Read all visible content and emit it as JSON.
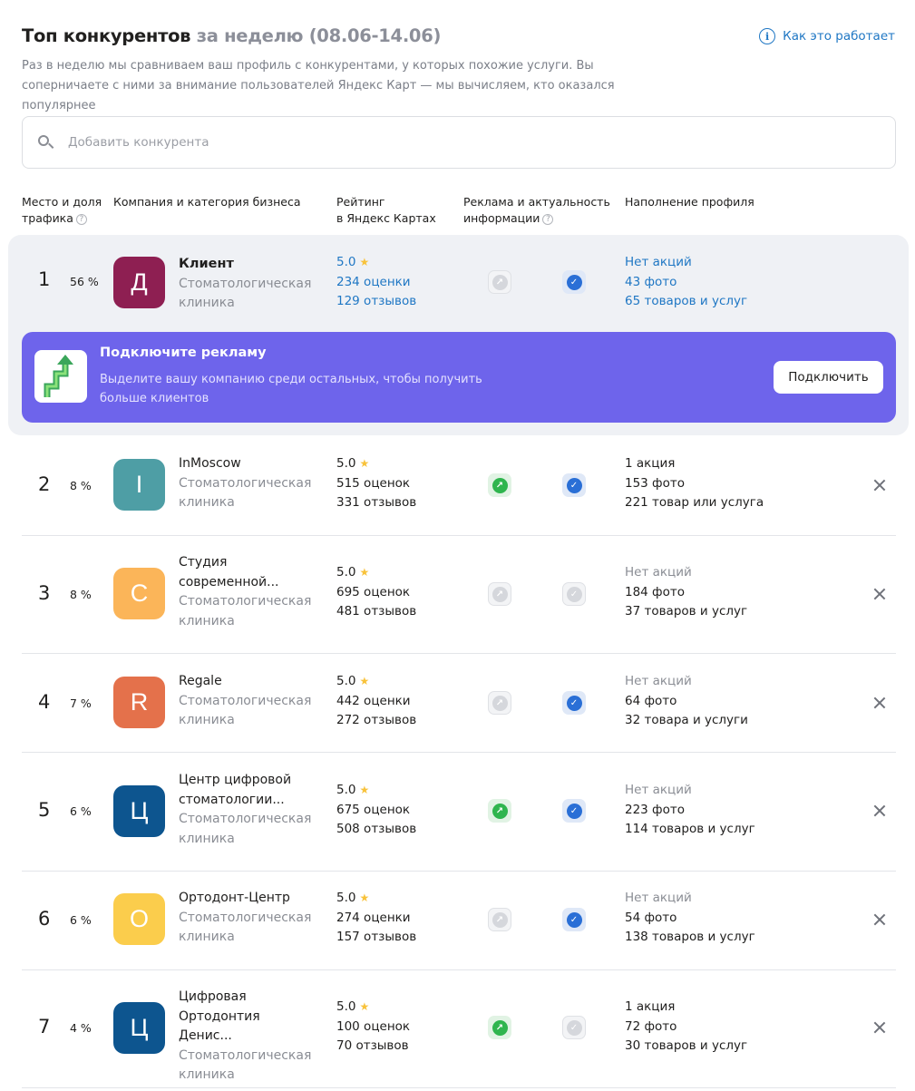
{
  "header": {
    "title_main": "Топ конкурентов",
    "title_period": "за неделю (08.06-14.06)",
    "howto_icon": "info-icon",
    "howto_label": "Как это работает",
    "description": "Раз в неделю мы сравниваем ваш профиль с конкурентами, у которых похожие услуги. Вы соперничаете с ними за внимание пользователей Яндекс Карт — мы вычисляем, кто оказался популярнее"
  },
  "search": {
    "icon": "search-icon",
    "placeholder": "Добавить конкурента"
  },
  "columns": {
    "place_line1": "Место и доля",
    "place_line2": "трафика",
    "company": "Компания и категория бизнеса",
    "rating_line1": "Рейтинг",
    "rating_line2": "в Яндекс Картах",
    "ads_line1": "Реклама и актуальность",
    "ads_line2": "информации",
    "fill": "Наполнение профиля",
    "help_icon": "question-icon"
  },
  "promo": {
    "title": "Подключите рекламу",
    "text": "Выделите вашу компанию среди остальных, чтобы получить больше клиентов",
    "button": "Подключить",
    "icon": "growth-arrow-icon",
    "color": "#6e64eb"
  },
  "competitors": [
    {
      "place": "1",
      "share": "56 %",
      "letter": "Д",
      "color": "#8e1f52",
      "name": "Клиент",
      "category": "Стоматологическая клиника",
      "rating": "5.0",
      "reviews_count": "234 оценки",
      "feedback_count": "129 отзывов",
      "ad_active": false,
      "info_actual": true,
      "promos": "Нет акций",
      "photos": "43 фото",
      "goods": "65 товаров и услуг"
    },
    {
      "place": "2",
      "share": "8 %",
      "letter": "I",
      "color": "#4e9ea5",
      "name": "InMoscow",
      "category": "Стоматологическая клиника",
      "rating": "5.0",
      "reviews_count": "515 оценок",
      "feedback_count": "331 отзывов",
      "ad_active": true,
      "info_actual": true,
      "promos": "1 акция",
      "photos": "153 фото",
      "goods": "221 товар или услуга"
    },
    {
      "place": "3",
      "share": "8 %",
      "letter": "С",
      "color": "#fbb559",
      "name": "Студия современной...",
      "category": "Стоматологическая клиника",
      "rating": "5.0",
      "reviews_count": "695 оценок",
      "feedback_count": "481 отзывов",
      "ad_active": false,
      "info_actual": false,
      "promos": "Нет акций",
      "photos": "184 фото",
      "goods": "37 товаров и услуг"
    },
    {
      "place": "4",
      "share": "7 %",
      "letter": "R",
      "color": "#e4714b",
      "name": "Regale",
      "category": "Стоматологическая клиника",
      "rating": "5.0",
      "reviews_count": "442 оценки",
      "feedback_count": "272 отзывов",
      "ad_active": false,
      "info_actual": true,
      "promos": "Нет акций",
      "photos": "64 фото",
      "goods": "32 товара и услуги"
    },
    {
      "place": "5",
      "share": "6 %",
      "letter": "Ц",
      "color": "#0d558f",
      "name": "Центр цифровой стоматологии...",
      "category": "Стоматологическая клиника",
      "rating": "5.0",
      "reviews_count": "675 оценок",
      "feedback_count": "508 отзывов",
      "ad_active": true,
      "info_actual": true,
      "promos": "Нет акций",
      "photos": "223 фото",
      "goods": "114 товаров и услуг"
    },
    {
      "place": "6",
      "share": "6 %",
      "letter": "О",
      "color": "#fbcd4c",
      "name": "Ортодонт-Центр",
      "category": "Стоматологическая клиника",
      "rating": "5.0",
      "reviews_count": "274 оценки",
      "feedback_count": "157 отзывов",
      "ad_active": false,
      "info_actual": true,
      "promos": "Нет акций",
      "photos": "54 фото",
      "goods": "138 товаров и услуг"
    },
    {
      "place": "7",
      "share": "4 %",
      "letter": "Ц",
      "color": "#0d558f",
      "name": "Цифровая Ортодонтия Денис...",
      "category": "Стоматологическая клиника",
      "rating": "5.0",
      "reviews_count": "100 оценок",
      "feedback_count": "70 отзывов",
      "ad_active": true,
      "info_actual": false,
      "promos": "1 акция",
      "photos": "72 фото",
      "goods": "30 товаров и услуг"
    }
  ]
}
